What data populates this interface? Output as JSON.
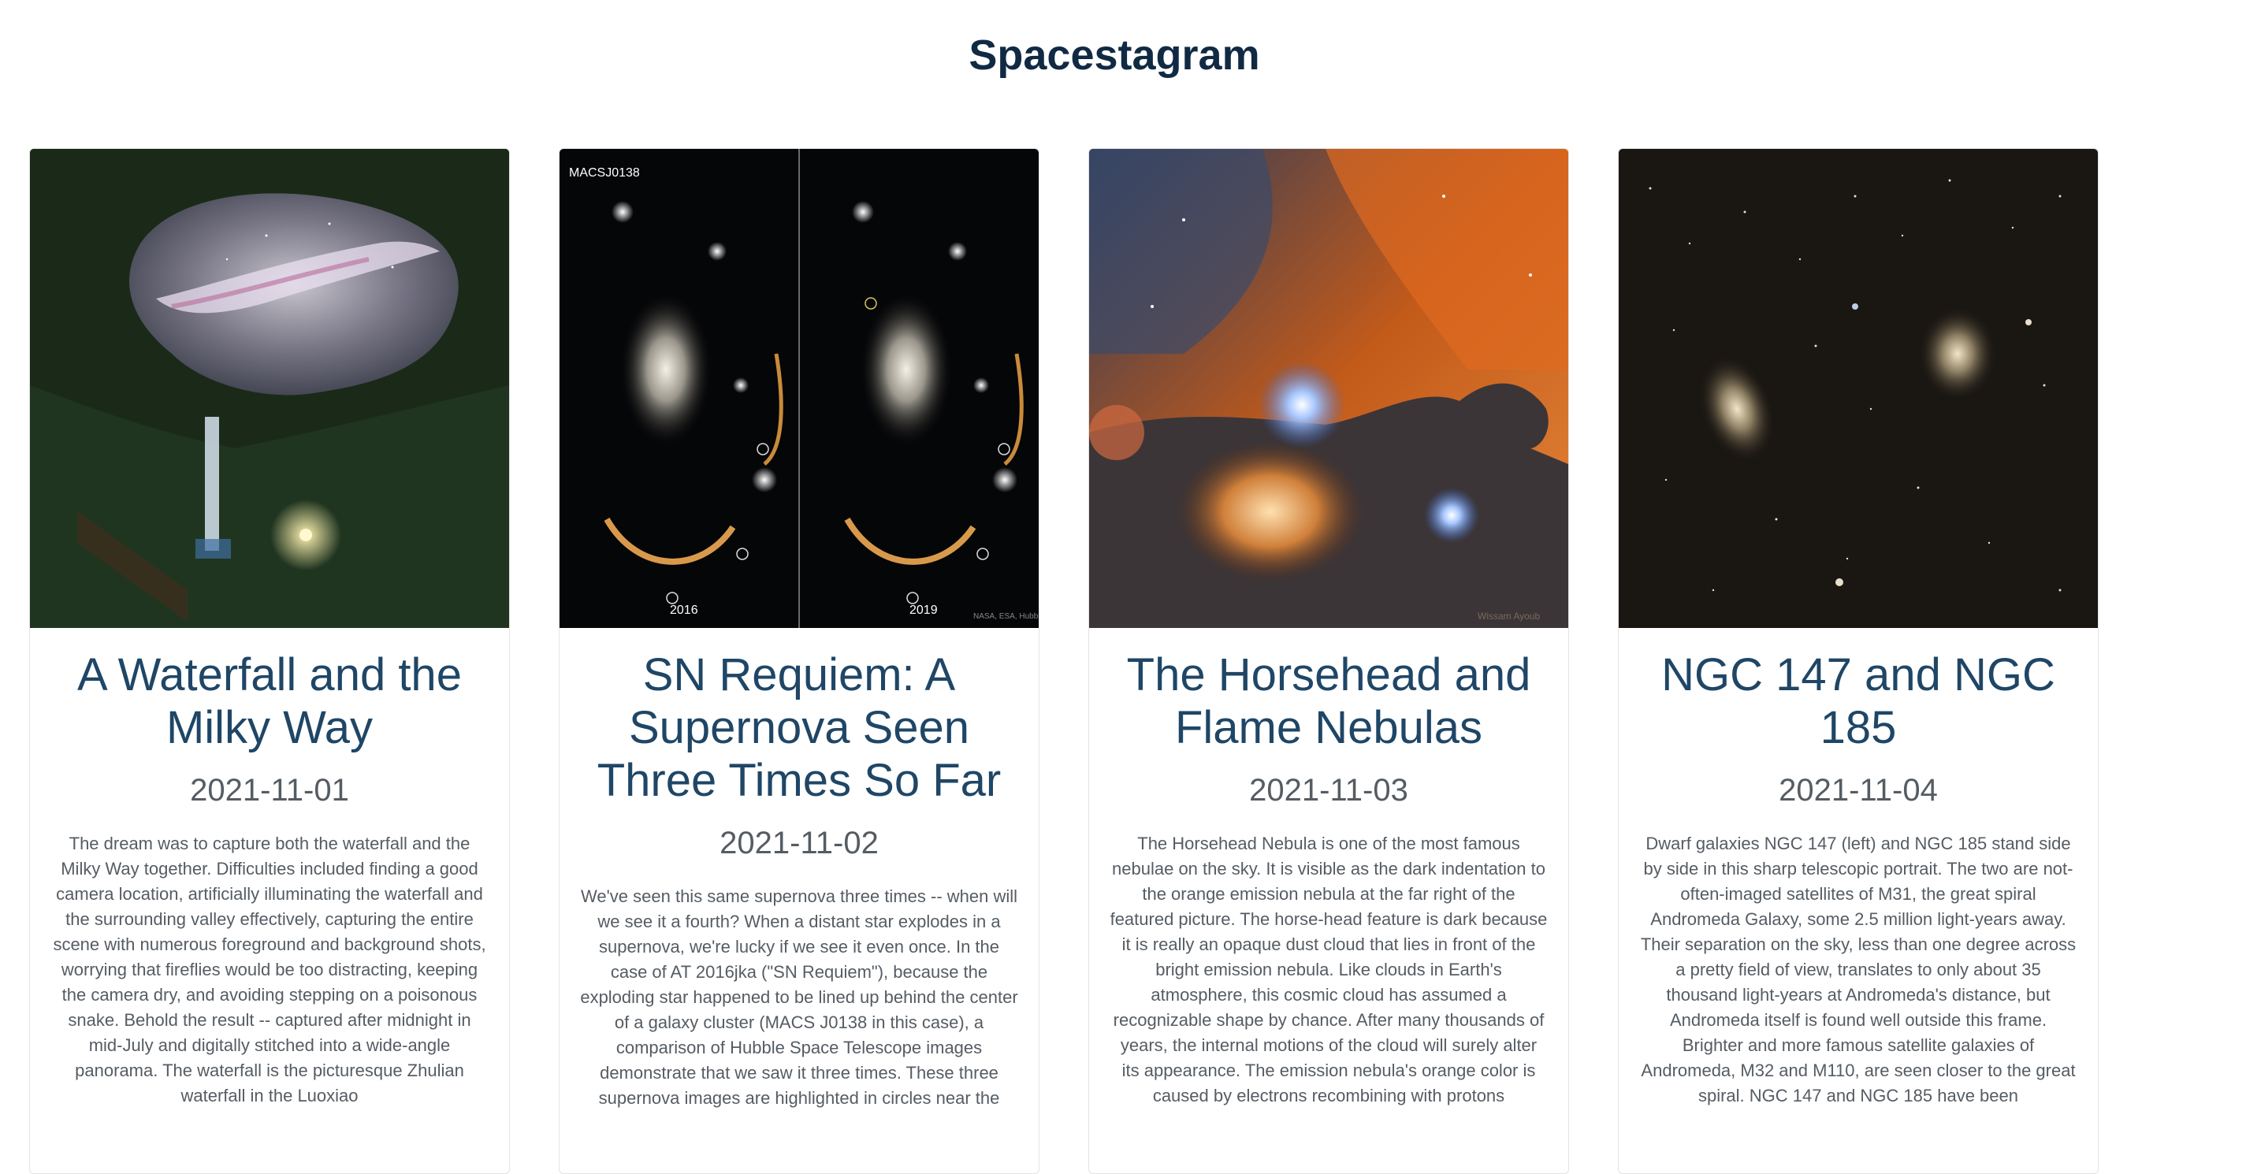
{
  "header": {
    "title": "Spacestagram"
  },
  "posts": [
    {
      "title": "A Waterfall and the Milky Way",
      "date": "2021-11-01",
      "description": "The dream was to capture both the waterfall and the Milky Way together. Difficulties included finding a good camera location, artificially illuminating the waterfall and the surrounding valley effectively, capturing the entire scene with numerous foreground and background shots, worrying that fireflies would be too distracting, keeping the camera dry, and avoiding stepping on a poisonous snake. Behold the result -- captured after midnight in mid-July and digitally stitched into a wide-angle panorama. The waterfall is the picturesque Zhulian waterfall in the Luoxiao",
      "image_alt": "waterfall-milky-way-photo"
    },
    {
      "title": "SN Requiem: A Supernova Seen Three Times So Far",
      "date": "2021-11-02",
      "description": "We've seen this same supernova three times -- when will we see it a fourth? When a distant star explodes in a supernova, we're lucky if we see it even once. In the case of AT 2016jka (\"SN Requiem\"), because the exploding star happened to be lined up behind the center of a galaxy cluster (MACS J0138 in this case), a comparison of Hubble Space Telescope images demonstrate that we saw it three times. These three supernova images are highlighted in circles near the",
      "image_alt": "supernova-comparison-photo",
      "image_labels": {
        "corner": "MACSJ0138",
        "left_year": "2016",
        "right_year": "2019",
        "credit": "NASA, ESA, Hubble"
      }
    },
    {
      "title": "The Horsehead and Flame Nebulas",
      "date": "2021-11-03",
      "description": "The Horsehead Nebula is one of the most famous nebulae on the sky. It is visible as the dark indentation to the orange emission nebula at the far right of the featured picture. The horse-head feature is dark because it is really an opaque dust cloud that lies in front of the bright emission nebula. Like clouds in Earth's atmosphere, this cosmic cloud has assumed a recognizable shape by chance. After many thousands of years, the internal motions of the cloud will surely alter its appearance. The emission nebula's orange color is caused by electrons recombining with protons",
      "image_alt": "horsehead-nebula-photo",
      "image_labels": {
        "credit": "Wissam Ayoub"
      }
    },
    {
      "title": "NGC 147 and NGC 185",
      "date": "2021-11-04",
      "description": "Dwarf galaxies NGC 147 (left) and NGC 185 stand side by side in this sharp telescopic portrait. The two are not-often-imaged satellites of M31, the great spiral Andromeda Galaxy, some 2.5 million light-years away. Their separation on the sky, less than one degree across a pretty field of view, translates to only about 35 thousand light-years at Andromeda's distance, but Andromeda itself is found well outside this frame. Brighter and more famous satellite galaxies of Andromeda, M32 and M110, are seen closer to the great spiral. NGC 147 and NGC 185 have been",
      "image_alt": "dwarf-galaxies-photo"
    }
  ]
}
